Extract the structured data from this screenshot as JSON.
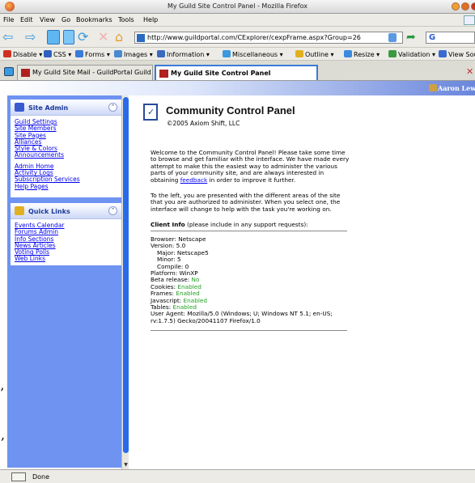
{
  "window": {
    "title": "My Guild Site Control Panel - Mozilla Firefox"
  },
  "menu": {
    "items": [
      {
        "label": "File"
      },
      {
        "label": "Edit"
      },
      {
        "label": "View"
      },
      {
        "label": "Go"
      },
      {
        "label": "Bookmarks"
      },
      {
        "label": "Tools"
      },
      {
        "label": "Help"
      }
    ]
  },
  "nav": {
    "url": "http://www.guildportal.com/CExplorer/cexpFrame.aspx?Group=26"
  },
  "devbar": {
    "items": [
      {
        "label": "Disable",
        "color": "#d03020"
      },
      {
        "label": "CSS",
        "color": "#3060c0"
      },
      {
        "label": "Forms",
        "color": "#3a7ad8"
      },
      {
        "label": "Images",
        "color": "#4a8ad0"
      },
      {
        "label": "Information",
        "color": "#3a6ac0"
      },
      {
        "label": "Miscellaneous",
        "color": "#3a9ae0"
      },
      {
        "label": "Outline",
        "color": "#e0b020"
      },
      {
        "label": "Resize",
        "color": "#3a8ae0"
      },
      {
        "label": "Validation",
        "color": "#3a9a40"
      },
      {
        "label": "View Source",
        "color": "#3a6ad0"
      }
    ]
  },
  "tabs": {
    "items": [
      {
        "label": "My Guild Site Mail - GuildPortal Guild Ho..."
      },
      {
        "label": "My Guild Site Control Panel"
      }
    ]
  },
  "header": {
    "user": "Aaron Lewis"
  },
  "sidebar": {
    "site_admin": {
      "title": "Site Admin",
      "links": [
        "Guild Settings",
        "Site Members",
        "Site Pages",
        "Alliances",
        "Style & Colors",
        "Announcements"
      ],
      "links2": [
        "Admin Home",
        "Activity Logs",
        "Subscription Services",
        "Help Pages"
      ]
    },
    "quick_links": {
      "title": "Quick Links",
      "links": [
        "Events Calendar",
        "Forums Admin",
        "Info Sections",
        "News Articles",
        "Voting Polls",
        "Web Links"
      ]
    }
  },
  "main": {
    "title": "Community Control Panel",
    "copyright": "©2005 Axiom Shift, LLC",
    "welcome_pre": "Welcome to the Community Control Panel!  Please take some time to browse and get familiar with the interface.  We have made every attempt to make this the easiest way to administer the various parts of your community site, and are always interested in obtaining",
    "feedback_link": "feedback",
    "welcome_post": "in order to improve it further.",
    "paragraph2": "To the left, you are presented with the different areas of the site that you are authorized to administer.  When you select one, the interface will change to help with the task you're working on.",
    "client_info_label": "Client Info",
    "client_info_note": "(please include in any support requests):",
    "client_info": {
      "browser": "Browser: Netscape",
      "version": "Version: 5.0",
      "major": "Major: Netscape5",
      "minor": "Minor: 5",
      "compile": "Compile: 0",
      "platform": "Platform: WinXP",
      "beta_label": "Beta release:",
      "beta_value": "No",
      "cookies_label": "Cookies:",
      "cookies_value": "Enabled",
      "frames_label": "Frames:",
      "frames_value": "Enabled",
      "javascript_label": "Javascript:",
      "javascript_value": "Enabled",
      "tables_label": "Tables:",
      "tables_value": "Enabled",
      "user_agent": "User Agent: Mozilla/5.0 (Windows; U; Windows NT 5.1; en-US; rv:1.7.5) Gecko/20041107 Firefox/1.0"
    }
  },
  "status": {
    "text": "Done"
  },
  "artifacts": {
    "a1": "’",
    "a2": ","
  }
}
